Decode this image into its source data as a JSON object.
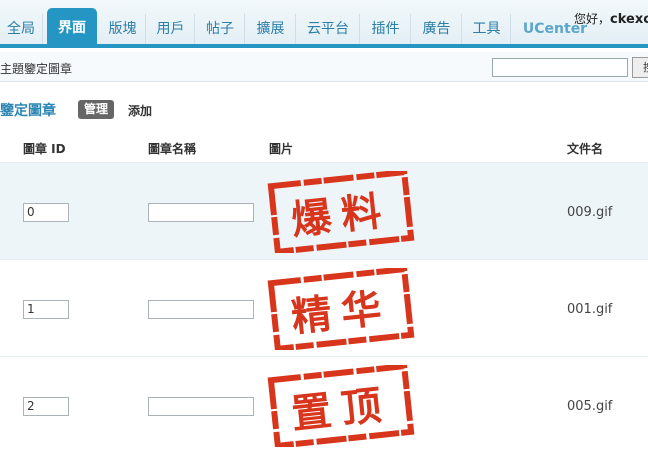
{
  "nav": {
    "tabs": [
      {
        "label": "全局"
      },
      {
        "label": "界面",
        "active": true
      },
      {
        "label": "版塊"
      },
      {
        "label": "用戶"
      },
      {
        "label": "帖子"
      },
      {
        "label": "擴展"
      },
      {
        "label": "云平台"
      },
      {
        "label": "插件"
      },
      {
        "label": "廣告"
      },
      {
        "label": "工具"
      },
      {
        "label": "UCenter"
      }
    ],
    "greeting": "您好，",
    "username": "ckexc"
  },
  "subbar": {
    "breadcrumb": "主題鑒定圖章",
    "search_value": "",
    "search_button_label": "搜"
  },
  "page": {
    "title": "鑒定圖章",
    "manage_label": "管理",
    "add_label": "添加"
  },
  "table": {
    "headers": {
      "id": "圖章  ID",
      "name": "圖章名稱",
      "image": "圖片",
      "filename": "文件名"
    },
    "rows": [
      {
        "id": "0",
        "name": "",
        "stamp_text": "爆料",
        "filename": "009.gif"
      },
      {
        "id": "1",
        "name": "",
        "stamp_text": "精华",
        "filename": "001.gif"
      },
      {
        "id": "2",
        "name": "",
        "stamp_text": "置顶",
        "filename": "005.gif"
      }
    ]
  },
  "colors": {
    "accent": "#2596c4",
    "stamp_red": "#d8351d"
  }
}
